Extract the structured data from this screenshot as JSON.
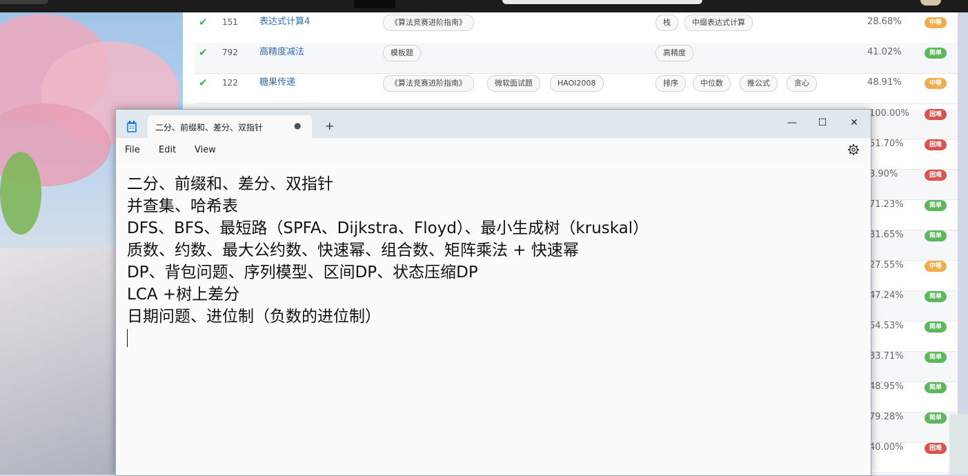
{
  "problem_list": {
    "rows": [
      {
        "id": "151",
        "title": "表达式计算4",
        "source_tags": [
          "《算法竞赛进阶指南》"
        ],
        "algo_tags": [
          "栈",
          "中缀表达式计算"
        ],
        "rate": "28.68%",
        "difficulty": "中等",
        "diff_color": "#f0ad4e"
      },
      {
        "id": "792",
        "title": "高精度减法",
        "source_tags": [
          "模板题"
        ],
        "algo_tags": [
          "高精度"
        ],
        "rate": "41.02%",
        "difficulty": "简单",
        "diff_color": "#5cb85c"
      },
      {
        "id": "122",
        "title": "糖果传递",
        "source_tags": [
          "《算法竞赛进阶指南》",
          "微软面试题",
          "HAOI2008"
        ],
        "algo_tags": [
          "排序",
          "中位数",
          "推公式",
          "贪心"
        ],
        "rate": "48.91%",
        "difficulty": "中等",
        "diff_color": "#f0ad4e"
      }
    ],
    "partial_rows": [
      {
        "rate": "100.00%",
        "difficulty": "困难",
        "diff_color": "#d9534f"
      },
      {
        "rate": "51.70%",
        "difficulty": "困难",
        "diff_color": "#d9534f"
      },
      {
        "rate": "3.90%",
        "difficulty": "困难",
        "diff_color": "#d9534f"
      },
      {
        "rate": "71.23%",
        "difficulty": "简单",
        "diff_color": "#5cb85c"
      },
      {
        "rate": "31.65%",
        "difficulty": "简单",
        "diff_color": "#5cb85c"
      },
      {
        "rate": "27.55%",
        "difficulty": "中等",
        "diff_color": "#f0ad4e"
      },
      {
        "rate": "47.24%",
        "difficulty": "简单",
        "diff_color": "#5cb85c"
      },
      {
        "rate": "54.53%",
        "difficulty": "简单",
        "diff_color": "#5cb85c"
      },
      {
        "rate": "33.71%",
        "difficulty": "简单",
        "diff_color": "#5cb85c"
      },
      {
        "rate": "48.95%",
        "difficulty": "简单",
        "diff_color": "#5cb85c"
      },
      {
        "rate": "79.28%",
        "difficulty": "简单",
        "diff_color": "#5cb85c"
      },
      {
        "rate": "40.00%",
        "difficulty": "困难",
        "diff_color": "#d9534f"
      }
    ]
  },
  "notepad": {
    "tab_title": "二分、前缀和、差分、双指针",
    "unsaved_indicator": "●",
    "new_tab": "+",
    "window_buttons": {
      "minimize": "—",
      "maximize": "☐",
      "close": "✕"
    },
    "menu": {
      "file": "File",
      "edit": "Edit",
      "view": "View"
    },
    "content_lines": [
      "二分、前缀和、差分、双指针",
      "并查集、哈希表",
      "DFS、BFS、最短路（SPFA、Dijkstra、Floyd）、最小生成树（kruskal）",
      "质数、约数、最大公约数、快速幂、组合数、矩阵乘法 + 快速幂",
      "DP、背包问题、序列模型、区间DP、状态压缩DP",
      "LCA +树上差分",
      "日期问题、进位制（负数的进位制）"
    ]
  }
}
